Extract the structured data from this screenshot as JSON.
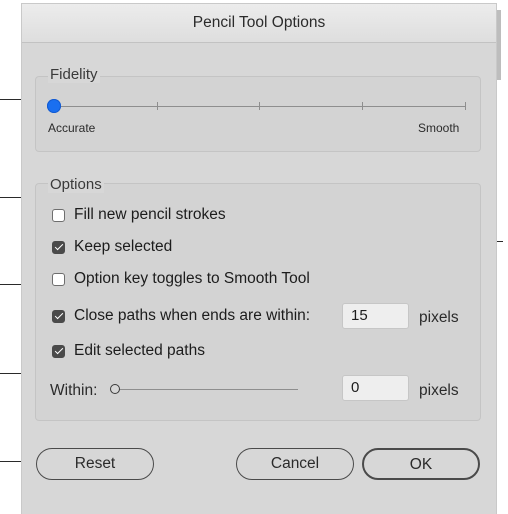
{
  "dialog": {
    "title": "Pencil Tool Options"
  },
  "fidelity": {
    "group_label": "Fidelity",
    "min_label": "Accurate",
    "max_label": "Smooth",
    "value": 0,
    "accent_color": "#1a6ff0"
  },
  "options": {
    "group_label": "Options",
    "fill_new_strokes": {
      "label": "Fill new pencil strokes",
      "checked": false
    },
    "keep_selected": {
      "label": "Keep selected",
      "checked": true
    },
    "option_key_toggles": {
      "label": "Option key toggles to Smooth Tool",
      "checked": false
    },
    "close_paths": {
      "label": "Close paths when ends are within:",
      "checked": true,
      "value": "15",
      "unit": "pixels"
    },
    "edit_selected": {
      "label": "Edit selected paths",
      "checked": true
    },
    "within": {
      "label": "Within:",
      "value": "0",
      "unit": "pixels",
      "slider_value": 0
    }
  },
  "buttons": {
    "reset": "Reset",
    "cancel": "Cancel",
    "ok": "OK"
  }
}
